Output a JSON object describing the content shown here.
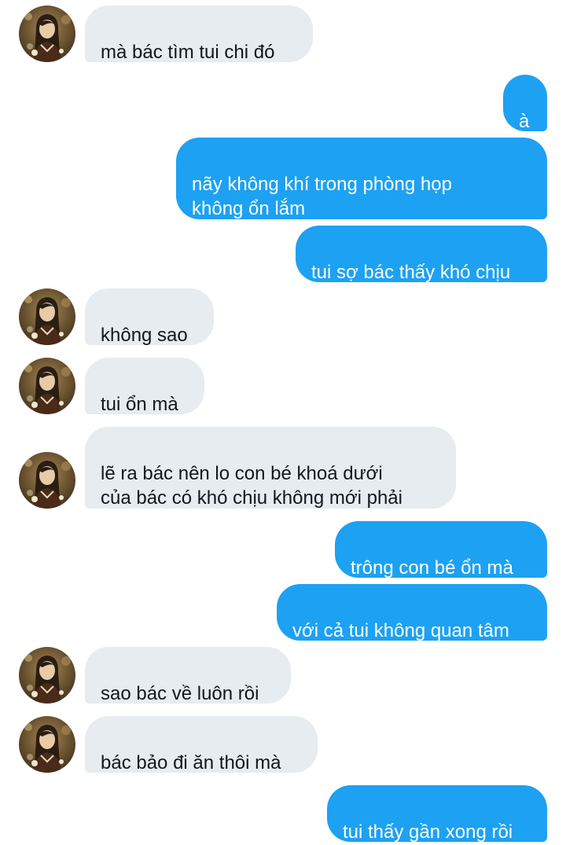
{
  "conversation": {
    "messages": [
      {
        "sender": "contact",
        "text": "mà bác tìm tui chi đó"
      },
      {
        "sender": "me",
        "text": "à"
      },
      {
        "sender": "me",
        "text": "nãy không khí trong phòng họp\nkhông ổn lắm"
      },
      {
        "sender": "me",
        "text": "tui sợ bác thấy khó chịu"
      },
      {
        "sender": "contact",
        "text": "không sao"
      },
      {
        "sender": "contact",
        "text": "tui ổn mà"
      },
      {
        "sender": "contact",
        "text": "lẽ ra bác nên lo con bé khoá dưới\ncủa bác có khó chịu không mới phải"
      },
      {
        "sender": "me",
        "text": "trông con bé ổn mà"
      },
      {
        "sender": "me",
        "text": "với cả tui không quan tâm"
      },
      {
        "sender": "contact",
        "text": "sao bác về luôn rồi"
      },
      {
        "sender": "contact",
        "text": "bác bảo đi ăn thôi mà"
      },
      {
        "sender": "me",
        "text": "tui thấy gần xong rồi"
      }
    ]
  },
  "colors": {
    "incoming_bubble": "#e6ecf0",
    "outgoing_bubble": "#1da1f2",
    "incoming_text": "#14171a",
    "outgoing_text": "#ffffff"
  },
  "icons": {
    "contact_avatar": "avatar-icon"
  }
}
